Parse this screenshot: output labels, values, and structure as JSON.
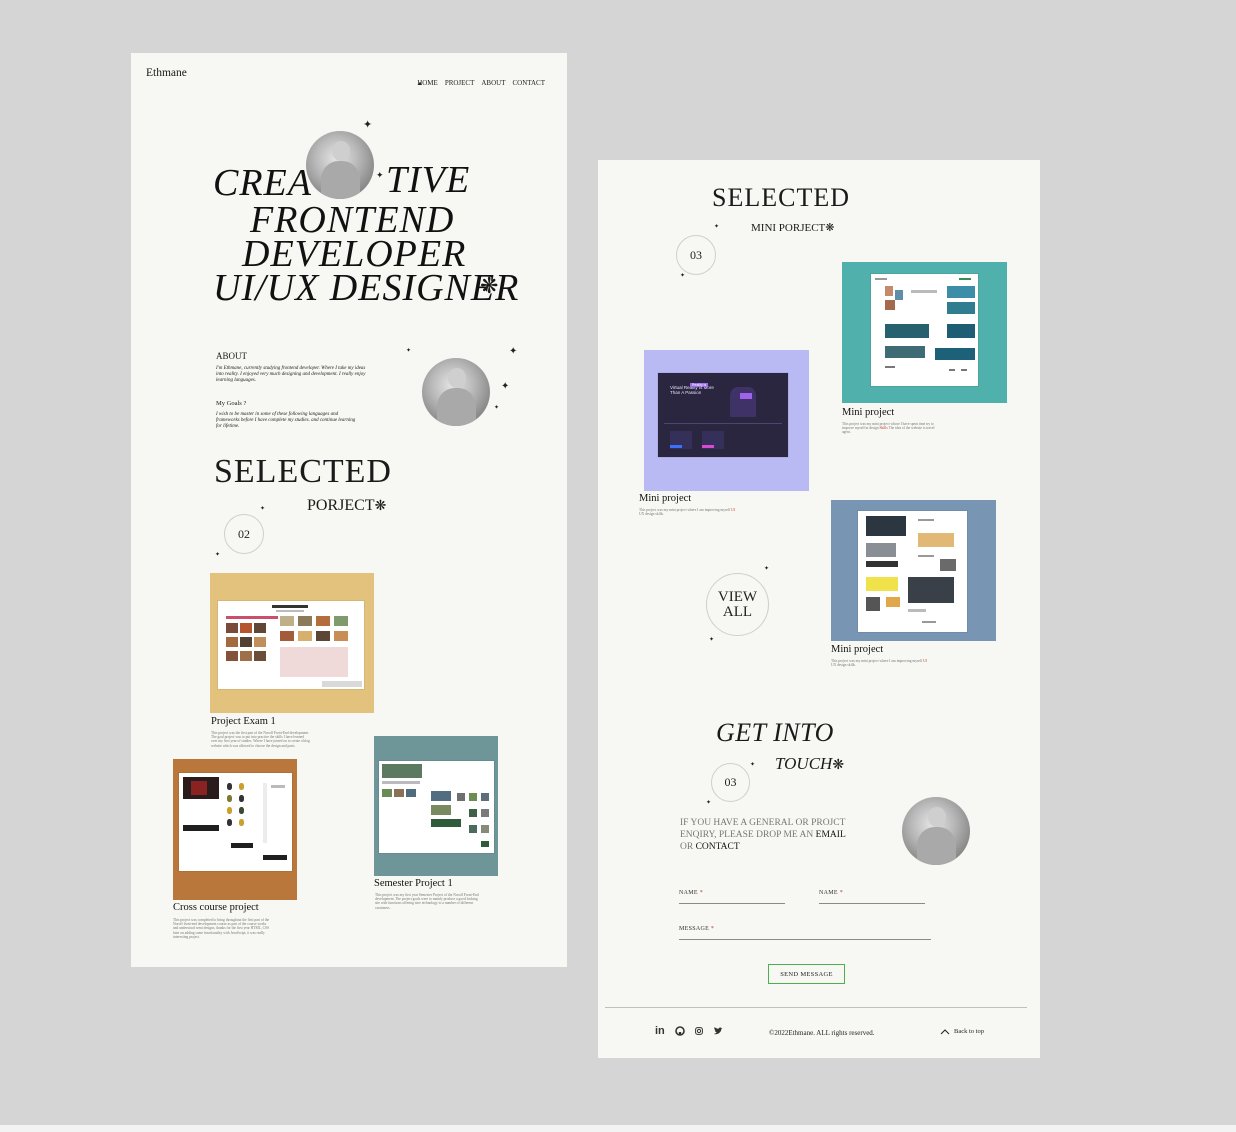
{
  "page1": {
    "brand": "Ethmane",
    "nav": [
      "HOME",
      "PROJECT",
      "ABOUT",
      "CONTACT"
    ],
    "hero": {
      "line1a": "CREA",
      "line1b": "TIVE",
      "line2": "FRONTEND",
      "line3": "DEVELOPER",
      "line4": "UI/UX DESIGNER"
    },
    "about": {
      "title": "ABOUT",
      "text": "I'm Ethmane, currently studying frontend developer. Where I take my ideas into reality. I enjoyed very much designing and development. I really enjoy learning languages.",
      "goals_title": "My Goals ?",
      "goals_text": "I wish to be master in some of these following languages and frameworks before I have complete my studies. and continue learning for lifetime."
    },
    "selected": {
      "title": "SELECTED",
      "subtitle": "PORJECT",
      "number": "02"
    },
    "projects": [
      {
        "name": "Project Exam 1",
        "desc": "This project was the first part of the Noroff Front-End development. The goal project was to put into practice the skills I have learned over my first year of studies. Where I have joined on to create a blog website which was allowed to choose the design and parts."
      },
      {
        "name": "Cross course project",
        "desc": "This project was completed to bring throughout the first part of the Noroff front-end development course as part of the course works and understood semi designs, thanks for the first year HTML, CSS later on adding some functionality with JavaScript, it was really interesting project."
      },
      {
        "name": "Semester Project 1",
        "desc": "This project was my first year Semester Project of the Noroff Front-End development. The project goals were to mainly produce a good looking site with functions offering nice technology to a number of different customers."
      }
    ]
  },
  "page2": {
    "selected": {
      "title": "SELECTED",
      "subtitle": "MINI PORJECT",
      "number": "03"
    },
    "mini_projects": [
      {
        "name": "Mini project",
        "desc": "This project was my mini project whose I have spent time try to improve myself in design ",
        "highlight": "Skills",
        "desc_after": " The idea of the website is travel agent."
      },
      {
        "name": "Mini project",
        "desc": "This project was my mini project where I am improving myself ",
        "highlight": "UI",
        "desc_after": " UX design skills."
      },
      {
        "name": "Mini project",
        "desc": "This project was my mini project where I am improving myself ",
        "highlight": "UI",
        "desc_after": " UX design skills."
      }
    ],
    "mini_thumb": {
      "headline": "Virtual Reality Is More Than A Passion",
      "badge": "Reality is"
    },
    "view_all": [
      "VIEW",
      "ALL"
    ],
    "contact": {
      "title1": "GET INTO",
      "title2": "TOUCH",
      "number": "03",
      "text1": "IF YOU HAVE A GENERAL OR PROJCT ENQIRY, PLEASE DROP ME AN ",
      "email": "EMAIL",
      "or": " OR ",
      "contact": "CONTACT",
      "field1": "NAME",
      "field2": "NAME",
      "field3": "MESSAGE",
      "required": "*",
      "button": "SEND MESSAGE"
    },
    "footer": {
      "copyright": "©2022Ethmane. ALL rights reserved.",
      "back_to_top": "Back to top",
      "social_icons": [
        "linkedin-icon",
        "github-icon",
        "instagram-icon",
        "twitter-icon"
      ]
    }
  },
  "colors": {
    "background": "#d5d5d5",
    "paper": "#f7f7f3",
    "exam_card": "#e2c27d",
    "cross_card": "#b9773b",
    "semester_card": "#6e9597",
    "mini_teal": "#4fb0ac",
    "mini_lavender": "#b9b9f4",
    "mini_blue": "#7895b3",
    "button_border": "#4caf50"
  }
}
